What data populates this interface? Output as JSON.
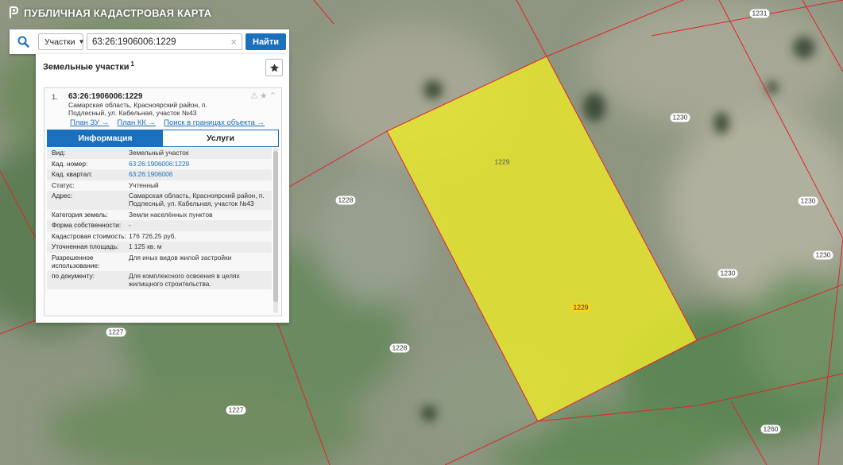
{
  "app": {
    "title": "ПУБЛИЧНАЯ КАДАСТРОВАЯ КАРТА"
  },
  "search": {
    "type_label": "Участки",
    "query": "63:26:1906006:1229",
    "button_label": "Найти",
    "clear": "×"
  },
  "panel": {
    "heading": "Земельные участки",
    "heading_count": "1",
    "result": {
      "index": "1.",
      "title": "63:26:1906006:1229",
      "address": "Самарская область, Красноярский район, п. Подлесный, ул. Кабельная, участок №43",
      "links": [
        "План ЗУ →",
        "План КК →",
        "Поиск в границах объекта →"
      ]
    },
    "tabs": [
      "Информация",
      "Услуги"
    ],
    "rows": [
      {
        "key": "Вид:",
        "value": "Земельный участок",
        "link": false
      },
      {
        "key": "Кад. номер:",
        "value": "63:26:1906006:1229",
        "link": true
      },
      {
        "key": "Кад. квартал:",
        "value": "63:26:1906006",
        "link": true
      },
      {
        "key": "Статус:",
        "value": "Учтенный",
        "link": false
      },
      {
        "key": "Адрес:",
        "value": "Самарская область, Красноярский район, п. Подлесный, ул. Кабельная, участок №43",
        "link": false
      },
      {
        "key": "Категория земель:",
        "value": "Земли населённых пунктов",
        "link": false
      },
      {
        "key": "Форма собственности:",
        "value": "-",
        "link": false
      },
      {
        "key": "Кадастровая стоимость:",
        "value": "176 726,25 руб.",
        "link": false
      },
      {
        "key": "Уточненная площадь:",
        "value": "1 125 кв. м",
        "link": false
      },
      {
        "key": "Разрешенное использование:",
        "value": "Для иных видов жилой застройки",
        "link": false
      },
      {
        "key": "по документу:",
        "value": "Для комплексного освоения в целях жилищного строительства.",
        "link": false
      }
    ]
  },
  "map": {
    "labels": [
      {
        "text": "1231",
        "style": "white"
      },
      {
        "text": "1230",
        "style": "white"
      },
      {
        "text": "1230",
        "style": "white"
      },
      {
        "text": "1230",
        "style": "white"
      },
      {
        "text": "1230",
        "style": "white"
      },
      {
        "text": "1229",
        "style": "yellow"
      },
      {
        "text": "1229",
        "style": "yellow2"
      },
      {
        "text": "1228",
        "style": "white"
      },
      {
        "text": "1228",
        "style": "white"
      },
      {
        "text": "1227",
        "style": "white"
      },
      {
        "text": "1227",
        "style": "white"
      },
      {
        "text": "1260",
        "style": "white"
      }
    ],
    "colors": {
      "boundary": "#e2222b",
      "selected_fill": "#e6e62e",
      "accent": "#1b70bd"
    }
  }
}
